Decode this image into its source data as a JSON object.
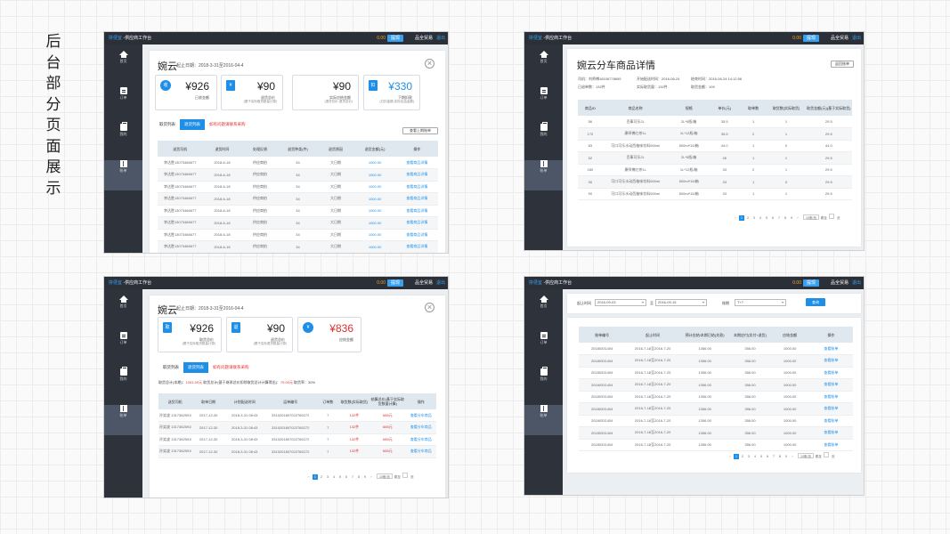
{
  "page_title_chars": [
    "后",
    "台",
    "部",
    "分",
    "页",
    "面",
    "展",
    "示"
  ],
  "topbar": {
    "brand_name": "拼便宜",
    "brand_suffix": " -供应商工作台",
    "balance": "0.00",
    "withdraw": "提现",
    "user": "品全贸易",
    "logout": "退出"
  },
  "sidebar": [
    {
      "label": "首页",
      "icon": "home-icon"
    },
    {
      "label": "订单",
      "icon": "order-icon"
    },
    {
      "label": "我的",
      "icon": "bag-icon"
    },
    {
      "label": "账单",
      "icon": "bill-icon"
    }
  ],
  "s1": {
    "title": "婉云",
    "date_range": "起止日期：2018-3-31至2016-04-4",
    "cards": [
      {
        "icon": "收",
        "amount": "¥926",
        "label": "已收金额",
        "note": ""
      },
      {
        "icon": "¥",
        "amount": "¥90",
        "label": "退货总价",
        "note": "(基于实际取货数量计算)"
      },
      {
        "icon": "",
        "amount": "¥90",
        "label": "退货总价",
        "note": ""
      },
      {
        "icon": "",
        "amount": "¥90",
        "label": "实际应结金额",
        "note": "(退货总价-退货总价)"
      },
      {
        "icon": "扣",
        "amount": "¥330",
        "label": "下期扣款",
        "note": "(已扣金额-实际应结金额)"
      }
    ],
    "tabs": [
      "取货列表",
      "退货列表",
      "如有问题请联系采购"
    ],
    "btn": "查看上期账单",
    "headers": [
      "送货司机",
      "退货时间",
      "处理反馈",
      "退货种类(件)",
      "退货原因",
      "退货金额(元)",
      "操作"
    ],
    "row": [
      "李达胜13073466677",
      "2018-6-18",
      "供应商拍",
      "34",
      "大日期",
      "1000.00",
      "查看商品详情"
    ],
    "nrows": 9
  },
  "s2": {
    "title": "婉云分车商品详情",
    "btn": "返回账单",
    "meta": [
      {
        "text": "司机：刘师傅18106778659"
      },
      {
        "text": "开始配送时间：2016-06-24"
      },
      {
        "text": "结束时间：2016-06-24 14:12:06"
      },
      {
        "text": "已退单数：132件"
      },
      {
        "text": "实际取货量：132件"
      },
      {
        "text": "取货金额：109"
      }
    ],
    "headers": [
      "商品ID",
      "商品名称",
      "规格",
      "单价(元)",
      "取单数",
      "取货数(实际取货)",
      "取货金额(元)(基于实际取货)"
    ],
    "rows": [
      [
        "56",
        "百事可乐2L",
        "2L*6瓶/箱",
        "35.5",
        "1",
        "1",
        "29.5"
      ],
      [
        "170",
        "康师傅红茶1L",
        "1L*12瓶/箱",
        "35.5",
        "2",
        "1",
        "29.5"
      ],
      [
        "83",
        "可口可乐水动西柚味饮料500ml",
        "500ml*15/箱",
        "44.0",
        "1",
        "0",
        "44.0"
      ],
      [
        "52",
        "百事可乐2L",
        "2L*6瓶/箱",
        "45",
        "1",
        "1",
        "29.5"
      ],
      [
        "180",
        "康师傅红茶1L",
        "1L*12瓶/箱",
        "33",
        "2",
        "1",
        "29.5"
      ],
      [
        "30",
        "可口可乐水动西柚味饮料500ml",
        "500ml*15/箱",
        "33",
        "1",
        "0",
        "29.5"
      ],
      [
        "90",
        "可口可乐水动西柚味饮料500ml",
        "500ml*15/箱",
        "33",
        "1",
        "1",
        "29.5"
      ]
    ]
  },
  "s3": {
    "title": "婉云",
    "date_range": "起止日期：2018-3-31至2016-04-4",
    "cards": [
      {
        "icon": "取",
        "amount": "¥926",
        "label": "取货总价",
        "note": "(基于实际取货数量计算)"
      },
      {
        "icon": "退",
        "amount": "¥90",
        "label": "退货总价",
        "note": "(基于实际退货数量计算)"
      },
      {
        "icon": "¥",
        "amount": "¥836",
        "label": "应结金额",
        "note": ""
      }
    ],
    "tabs": [
      "取货列表",
      "退货列表",
      "如有问题请联系采购"
    ],
    "summary": {
      "a_label": "取货总计(本期)：",
      "a_val": "1261.00元",
      "b_label": "取货总计(基于继承总价扣除取货总计计算得出)：",
      "b_val": "79.00元",
      "c_label": "取货率：",
      "c_val": "30%"
    },
    "headers": [
      "送货司机",
      "取单日期",
      "计划配送时间",
      "运单编号",
      "订单数",
      "取货数(实际取货)",
      "结算总价(基于实际取货数量计算)",
      "操作"
    ],
    "rows": [
      [
        "孙笑波 13173625915",
        "2017-12-30",
        "2018-3-31 08:43",
        "3310201807022765272",
        "7",
        "132件",
        "685元",
        "查看分车商品"
      ],
      [
        "孙笑波 13173625915",
        "2017-12-30",
        "2018-3-31 08:43",
        "3310201807022765272",
        "7",
        "132件",
        "685元",
        "查看分车商品"
      ],
      [
        "孙笑波 13173625915",
        "2017-12-30",
        "2018-3-31 08:43",
        "3310201807022765272",
        "7",
        "132件",
        "685元",
        "查看分车商品"
      ],
      [
        "孙笑波 13173625915",
        "2017-12-30",
        "2018-3-31 08:43",
        "3310201807022765272",
        "7",
        "132件",
        "685元",
        "查看分车商品"
      ]
    ]
  },
  "s4": {
    "filters": {
      "start_label": "起止时间",
      "start_val": "2016-09-03",
      "to": "至",
      "end_val": "2016-09-15",
      "cycle_label": "账期",
      "cycle_val": "T+7",
      "query": "查询"
    },
    "headers": [
      "账单编号",
      "起止时间",
      "预计应结/本期已结(先款)",
      "本期应付(实付+退货)",
      "应结金额",
      "操作"
    ],
    "row": [
      "20180331404",
      "2016-7-18至2016-7-20",
      "1356.00",
      "356.00",
      "1000.00",
      "查看账单"
    ],
    "nrows": 9
  },
  "pager": {
    "pages": [
      "1",
      "2",
      "3",
      "4",
      "5",
      "6",
      "7",
      "8",
      "9"
    ],
    "per": "10条/页",
    "goto": "跳至",
    "unit": "页"
  }
}
